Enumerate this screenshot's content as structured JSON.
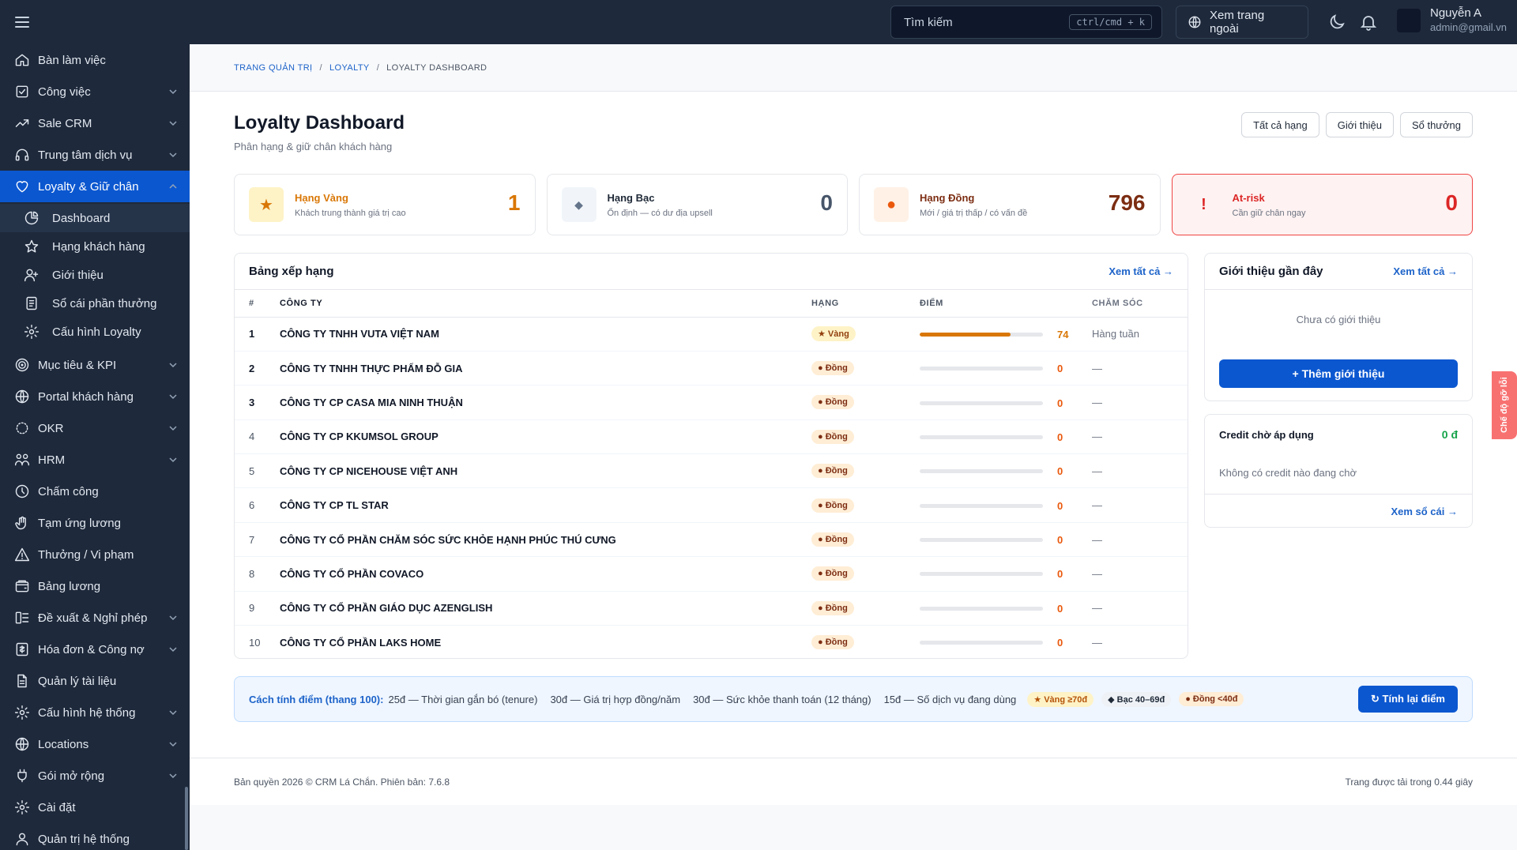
{
  "topbar": {
    "search_placeholder": "Tìm kiếm",
    "search_shortcut": "ctrl/cmd + k",
    "view_site": "Xem trang ngoài",
    "user_name": "Nguyễn A",
    "user_email": "admin@gmail.vn"
  },
  "sidebar": {
    "items": [
      {
        "label": "Bàn làm việc",
        "icon": "home-icon",
        "chevron": false
      },
      {
        "label": "Công việc",
        "icon": "task-check-icon",
        "chevron": true
      },
      {
        "label": "Sale CRM",
        "icon": "trend-up-icon",
        "chevron": true
      },
      {
        "label": "Trung tâm dịch vụ",
        "icon": "headset-icon",
        "chevron": true
      },
      {
        "label": "Loyalty & Giữ chân",
        "icon": "heart-icon",
        "chevron": true,
        "active": true
      },
      {
        "label": "Mục tiêu & KPI",
        "icon": "target-icon",
        "chevron": true
      },
      {
        "label": "Portal khách hàng",
        "icon": "globe-icon",
        "chevron": true
      },
      {
        "label": "OKR",
        "icon": "okr-circle-icon",
        "chevron": true
      },
      {
        "label": "HRM",
        "icon": "org-chart-icon",
        "chevron": true
      },
      {
        "label": "Chấm công",
        "icon": "clock-icon",
        "chevron": false
      },
      {
        "label": "Tạm ứng lương",
        "icon": "hand-icon",
        "chevron": false
      },
      {
        "label": "Thưởng / Vi phạm",
        "icon": "warning-icon",
        "chevron": false
      },
      {
        "label": "Bảng lương",
        "icon": "wallet-icon",
        "chevron": false
      },
      {
        "label": "Đề xuất & Nghỉ phép",
        "icon": "request-icon",
        "chevron": true
      },
      {
        "label": "Hóa đơn & Công nợ",
        "icon": "invoice-icon",
        "chevron": true
      },
      {
        "label": "Quản lý tài liệu",
        "icon": "document-icon",
        "chevron": false
      },
      {
        "label": "Cấu hình hệ thống",
        "icon": "gear-icon",
        "chevron": true
      },
      {
        "label": "Locations",
        "icon": "globe-icon",
        "chevron": true
      },
      {
        "label": "Gói mở rộng",
        "icon": "plugin-icon",
        "chevron": true
      },
      {
        "label": "Cài đặt",
        "icon": "gear-icon",
        "chevron": false
      },
      {
        "label": "Quản trị hệ thống",
        "icon": "user-admin-icon",
        "chevron": false
      }
    ],
    "sub_items": [
      {
        "label": "Dashboard",
        "icon": "pie-chart-icon",
        "active": true
      },
      {
        "label": "Hạng khách hàng",
        "icon": "star-icon"
      },
      {
        "label": "Giới thiệu",
        "icon": "user-plus-icon"
      },
      {
        "label": "Sổ cái phần thưởng",
        "icon": "ledger-icon"
      },
      {
        "label": "Cấu hình Loyalty",
        "icon": "gear-icon"
      }
    ]
  },
  "breadcrumb": {
    "home": "TRANG QUẢN TRỊ",
    "section": "LOYALTY",
    "current": "LOYALTY DASHBOARD"
  },
  "page": {
    "title": "Loyalty Dashboard",
    "subtitle": "Phân hạng & giữ chân khách hàng"
  },
  "header_buttons": {
    "all_tiers": "Tất cả hạng",
    "referral": "Giới thiệu",
    "rewards": "Sổ thưởng"
  },
  "tiers": [
    {
      "name": "Hạng Vàng",
      "desc": "Khách trung thành giá trị cao",
      "value": "1",
      "color": "#d97706",
      "glyph": "★"
    },
    {
      "name": "Hạng Bạc",
      "desc": "Ổn định — có dư địa upsell",
      "value": "0",
      "color": "#475569",
      "glyph": "◆"
    },
    {
      "name": "Hạng Đồng",
      "desc": "Mới / giá trị thấp / có vấn đề",
      "value": "796",
      "color": "#7c2d12",
      "glyph": "●"
    },
    {
      "name": "At-risk",
      "desc": "Cần giữ chân ngay",
      "value": "0",
      "color": "#dc2626",
      "glyph": "!"
    }
  ],
  "ranking": {
    "title": "Bảng xếp hạng",
    "view_all": "Xem tất cả →",
    "columns": [
      "#",
      "CÔNG TY",
      "HẠNG",
      "ĐIỂM",
      "CHĂM SÓC"
    ],
    "rows": [
      {
        "rank": "1",
        "company": "CÔNG TY TNHH VUTA VIỆT NAM",
        "tier": "★ Vàng",
        "tier_kind": "gold",
        "score": 74,
        "care": "Hàng tuần"
      },
      {
        "rank": "2",
        "company": "CÔNG TY TNHH THỰC PHẨM ĐỖ GIA",
        "tier": "● Đồng",
        "tier_kind": "bronze",
        "score": 0,
        "care": "—"
      },
      {
        "rank": "3",
        "company": "CÔNG TY CP CASA MIA NINH THUẬN",
        "tier": "● Đồng",
        "tier_kind": "bronze",
        "score": 0,
        "care": "—"
      },
      {
        "rank": "4",
        "company": "CÔNG TY CP KKUMSOL GROUP",
        "tier": "● Đồng",
        "tier_kind": "bronze",
        "score": 0,
        "care": "—"
      },
      {
        "rank": "5",
        "company": "CÔNG TY CP NICEHOUSE VIỆT ANH",
        "tier": "● Đồng",
        "tier_kind": "bronze",
        "score": 0,
        "care": "—"
      },
      {
        "rank": "6",
        "company": "CÔNG TY CP TL STAR",
        "tier": "● Đồng",
        "tier_kind": "bronze",
        "score": 0,
        "care": "—"
      },
      {
        "rank": "7",
        "company": "CÔNG TY CỔ PHẦN CHĂM SÓC SỨC KHỎE HẠNH PHÚC THÚ CƯNG",
        "tier": "● Đồng",
        "tier_kind": "bronze",
        "score": 0,
        "care": "—"
      },
      {
        "rank": "8",
        "company": "CÔNG TY CỔ PHẦN COVACO",
        "tier": "● Đồng",
        "tier_kind": "bronze",
        "score": 0,
        "care": "—"
      },
      {
        "rank": "9",
        "company": "CÔNG TY CỔ PHẦN GIÁO DỤC AZENGLISH",
        "tier": "● Đồng",
        "tier_kind": "bronze",
        "score": 0,
        "care": "—"
      },
      {
        "rank": "10",
        "company": "CÔNG TY CỔ PHẦN LAKS HOME",
        "tier": "● Đồng",
        "tier_kind": "bronze",
        "score": 0,
        "care": "—"
      }
    ]
  },
  "referrals": {
    "title": "Giới thiệu gần đây",
    "view_all": "Xem tất cả →",
    "empty": "Chưa có giới thiệu",
    "add_button": "+ Thêm giới thiệu"
  },
  "credit": {
    "title": "Credit chờ áp dụng",
    "amount": "0 đ",
    "empty": "Không có credit nào đang chờ",
    "view_ledger": "Xem sổ cái →"
  },
  "scoring": {
    "label": "Cách tính điểm (thang 100):",
    "rules": [
      "25đ — Thời gian gắn bó (tenure)",
      "30đ — Giá trị hợp đồng/năm",
      "30đ — Sức khỏe thanh toán (12 tháng)",
      "15đ — Số dịch vụ đang dùng"
    ],
    "tags": {
      "gold": "★ Vàng ≥70đ",
      "silver": "◆ Bạc 40–69đ",
      "bronze": "● Đồng <40đ"
    },
    "recalc_button": "↻ Tính lại điểm"
  },
  "footer": {
    "copyright": "Bản quyền 2026 © CRM Lá Chắn. Phiên bản: 7.6.8",
    "load_time": "Trang được tải trong 0.44 giây"
  },
  "side_tab": "Chế độ gỡ lỗi",
  "colors": {
    "primary": "#0b57d0",
    "sidebar_bg": "#1e293b",
    "gold": "#d97706",
    "bronze": "#7c2d12",
    "risk": "#dc2626",
    "score_zero": "#ea580c"
  }
}
